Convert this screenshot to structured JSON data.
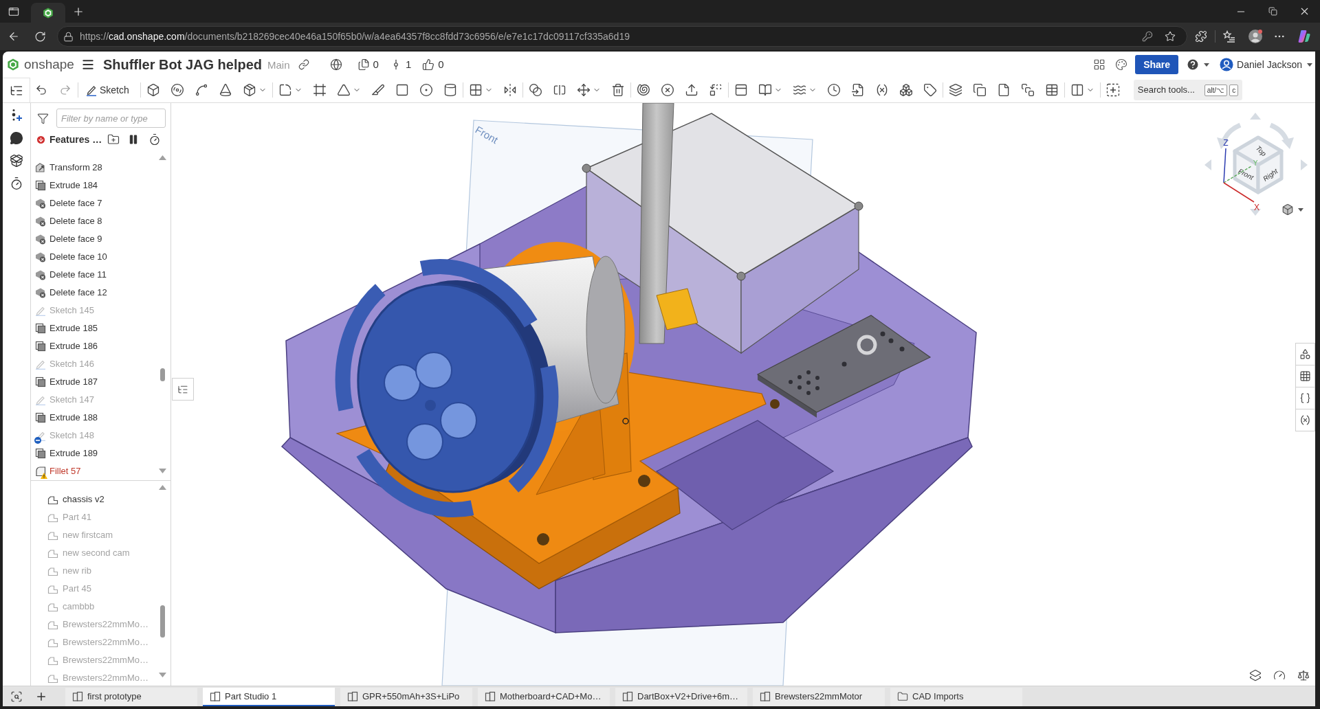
{
  "browser": {
    "url": {
      "scheme": "https://",
      "host": "cad.onshape.com",
      "path": "/documents/b218269cec40e46a150f65b0/w/a4ea64357f8cc8fdd73c6956/e/e7e1c17dc09117cf335a6d19"
    }
  },
  "header": {
    "logo_text": "onshape",
    "document_title": "Shuffler Bot JAG helped",
    "branch": "Main",
    "counters": [
      {
        "kind": "copies",
        "value": "0"
      },
      {
        "kind": "versions",
        "value": "1"
      },
      {
        "kind": "likes",
        "value": "0"
      }
    ],
    "share_button": "Share",
    "user_name": "Daniel Jackson"
  },
  "toolbar": {
    "sketch_button": "Sketch",
    "search": {
      "placeholder": "Search tools...",
      "shortcut_keys": [
        "alt/⌥",
        "c"
      ]
    }
  },
  "feature_panel": {
    "filter": {
      "placeholder": "Filter by name or type"
    },
    "title": "Features …",
    "features": [
      {
        "kind": "transform",
        "label": "Transform 28",
        "dimmed": false,
        "error": false,
        "excluded": false
      },
      {
        "kind": "extrude",
        "label": "Extrude 184",
        "dimmed": false,
        "error": false,
        "excluded": false
      },
      {
        "kind": "delete_face",
        "label": "Delete face 7",
        "dimmed": false,
        "error": false,
        "excluded": false
      },
      {
        "kind": "delete_face",
        "label": "Delete face 8",
        "dimmed": false,
        "error": false,
        "excluded": false
      },
      {
        "kind": "delete_face",
        "label": "Delete face 9",
        "dimmed": false,
        "error": false,
        "excluded": false
      },
      {
        "kind": "delete_face",
        "label": "Delete face 10",
        "dimmed": false,
        "error": false,
        "excluded": false
      },
      {
        "kind": "delete_face",
        "label": "Delete face 11",
        "dimmed": false,
        "error": false,
        "excluded": false
      },
      {
        "kind": "delete_face",
        "label": "Delete face 12",
        "dimmed": false,
        "error": false,
        "excluded": false
      },
      {
        "kind": "sketch",
        "label": "Sketch 145",
        "dimmed": true,
        "error": false,
        "excluded": false
      },
      {
        "kind": "extrude",
        "label": "Extrude 185",
        "dimmed": false,
        "error": false,
        "excluded": false
      },
      {
        "kind": "extrude",
        "label": "Extrude 186",
        "dimmed": false,
        "error": false,
        "excluded": false
      },
      {
        "kind": "sketch",
        "label": "Sketch 146",
        "dimmed": true,
        "error": false,
        "excluded": false
      },
      {
        "kind": "extrude",
        "label": "Extrude 187",
        "dimmed": false,
        "error": false,
        "excluded": false
      },
      {
        "kind": "sketch",
        "label": "Sketch 147",
        "dimmed": true,
        "error": false,
        "excluded": false
      },
      {
        "kind": "extrude",
        "label": "Extrude 188",
        "dimmed": false,
        "error": false,
        "excluded": false
      },
      {
        "kind": "sketch",
        "label": "Sketch 148",
        "dimmed": true,
        "error": false,
        "excluded": true
      },
      {
        "kind": "extrude",
        "label": "Extrude 189",
        "dimmed": false,
        "error": false,
        "excluded": false
      },
      {
        "kind": "fillet",
        "label": "Fillet 57",
        "dimmed": false,
        "error": true,
        "excluded": false
      }
    ],
    "parts": [
      {
        "label": "chassis v2",
        "dimmed": false
      },
      {
        "label": "Part 41",
        "dimmed": true
      },
      {
        "label": "new firstcam",
        "dimmed": true
      },
      {
        "label": "new second cam",
        "dimmed": true
      },
      {
        "label": "new rib",
        "dimmed": true
      },
      {
        "label": "Part 45",
        "dimmed": true
      },
      {
        "label": "cambbb",
        "dimmed": true
      },
      {
        "label": "Brewsters22mmMo…",
        "dimmed": true
      },
      {
        "label": "Brewsters22mmMo…",
        "dimmed": true
      },
      {
        "label": "Brewsters22mmMo…",
        "dimmed": true
      },
      {
        "label": "Brewsters22mmMo…",
        "dimmed": true
      }
    ]
  },
  "viewport": {
    "plane_label": "Front",
    "view_cube": {
      "top": "Top",
      "front": "Front",
      "right": "Right",
      "x_axis": "X",
      "y_axis": "Y",
      "z_axis": "Z"
    }
  },
  "document_tabs": [
    {
      "kind": "part_studio",
      "label": "first prototype",
      "selected": false
    },
    {
      "kind": "part_studio",
      "label": "Part Studio 1",
      "selected": true
    },
    {
      "kind": "part_studio",
      "label": "GPR+550mAh+3S+LiPo",
      "selected": false
    },
    {
      "kind": "part_studio",
      "label": "Motherboard+CAD+Mo…",
      "selected": false
    },
    {
      "kind": "part_studio",
      "label": "DartBox+V2+Drive+6m…",
      "selected": false
    },
    {
      "kind": "part_studio",
      "label": "Brewsters22mmMotor",
      "selected": false
    },
    {
      "kind": "folder",
      "label": "CAD Imports",
      "selected": false
    }
  ]
}
